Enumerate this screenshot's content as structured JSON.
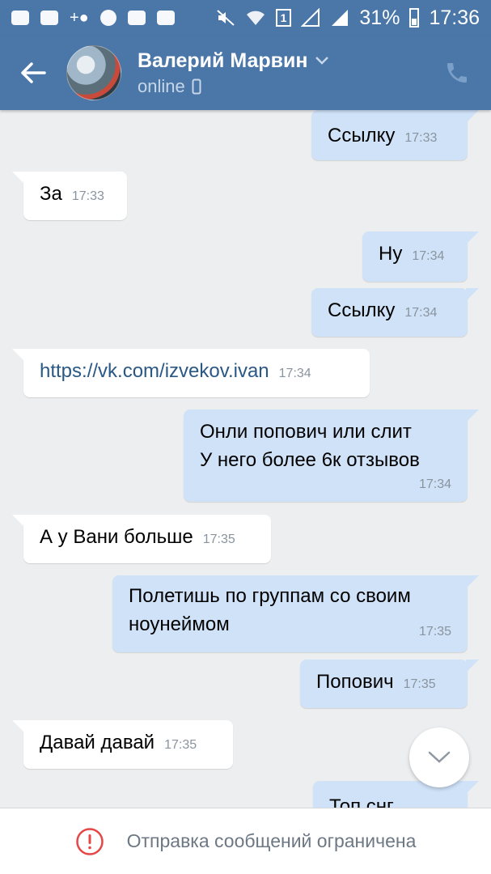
{
  "status_bar": {
    "sim": "1",
    "battery_percent": "31%",
    "time": "17:36",
    "icons": [
      "chat-icon",
      "gallery-icon",
      "add-user-icon",
      "message-icon",
      "youtube-icon",
      "youtube-icon",
      "mute-icon",
      "wifi-icon",
      "signal-icon",
      "signal-icon",
      "battery-icon"
    ]
  },
  "header": {
    "name": "Валерий Марвин",
    "status": "online",
    "accent": "#4a76a8"
  },
  "messages": [
    {
      "dir": "out",
      "text": "Ссылку",
      "time": "17:33"
    },
    {
      "dir": "in",
      "text": "За",
      "time": "17:33"
    },
    {
      "dir": "out",
      "text": "Ну",
      "time": "17:34"
    },
    {
      "dir": "out",
      "text": "Ссылку",
      "time": "17:34"
    },
    {
      "dir": "in",
      "text": "https://vk.com/izvekov.ivan",
      "time": "17:34",
      "link": true
    },
    {
      "dir": "out",
      "text": "Онли попович или слит",
      "text2": "У него более 6к отзывов",
      "time": "17:34"
    },
    {
      "dir": "in",
      "text": "А у Вани больше",
      "time": "17:35"
    },
    {
      "dir": "out",
      "text": "Полетишь по группам со своим",
      "text2": "ноунеймом",
      "time": "17:35"
    },
    {
      "dir": "out",
      "text": "Попович",
      "time": "17:35"
    },
    {
      "dir": "in",
      "text": "Давай давай",
      "time": "17:35"
    },
    {
      "dir": "out",
      "text": "Топ снг",
      "time": ""
    }
  ],
  "footer": {
    "restriction_text": "Отправка сообщений ограничена",
    "alert_color": "#e64646"
  }
}
